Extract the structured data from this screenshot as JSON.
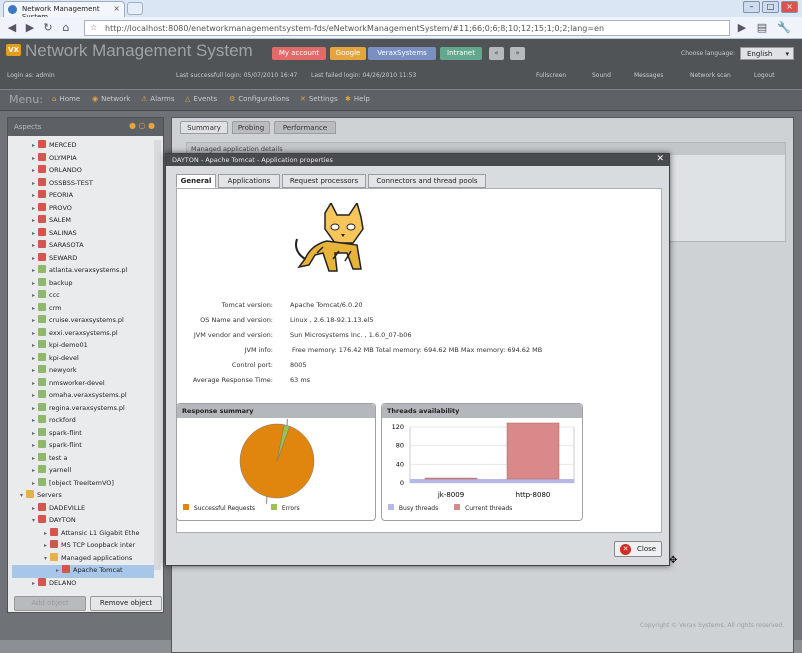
{
  "browser": {
    "tab_title": "Network Management System",
    "url": "http://localhost:8080/enetworkmanagementsystem-fds/eNetworkManagementSystem/#11;66;0;6;8;10;12;15;1;0;2;lang=en"
  },
  "app": {
    "logo": "VX",
    "title": "Network Management System",
    "quick_buttons": [
      {
        "label": "My account",
        "color": "#e46a6a"
      },
      {
        "label": "Google",
        "color": "#e5a43c"
      },
      {
        "label": "VeraxSystems",
        "color": "#7a8fc2"
      },
      {
        "label": "Intranet",
        "color": "#62a88e"
      }
    ],
    "choose_language_label": "Choose language:",
    "language": "English",
    "login_as": "Login as: admin",
    "last_success": "Last successfull login: 05/07/2010 16:47",
    "last_failed": "Last failed login: 04/26/2010 11:53",
    "top_links": [
      "Fullscreen",
      "Sound",
      "Messages",
      "Network scan",
      "Logout"
    ],
    "menu_label": "Menu:",
    "menu": [
      "Home",
      "Network",
      "Alarms",
      "Events",
      "Configurations",
      "Settings",
      "Help"
    ]
  },
  "aspects": {
    "title": "Aspects",
    "tree": [
      "MERCED",
      "OLYMPIA",
      "ORLANDO",
      "OSSBSS-TEST",
      "PEORIA",
      "PROVO",
      "SALEM",
      "SALINAS",
      "SARASOTA",
      "SEWARD",
      "atlanta.veraxsystems.pl",
      "backup",
      "ccc",
      "crm",
      "cruise.veraxsystems.pl",
      "exxi.veraxsystems.pl",
      "kpi-demo01",
      "kpi-devel",
      "newyork",
      "nmsworker-devel",
      "omaha.veraxsystems.pl",
      "regina.veraxsystems.pl",
      "rockford",
      "spark-flint",
      "spark-flint",
      "test a",
      "yarnell",
      "[object TreeItemVO]",
      "Servers",
      "DADEVILLE",
      "DAYTON",
      "Attansic L1 Gigabit Ethe",
      "MS TCP Loopback inter",
      "Managed applications",
      "Apache Tomcat",
      "DELANO"
    ],
    "add_button": "Add object",
    "remove_button": "Remove object"
  },
  "main": {
    "tabs": [
      "Summary",
      "Probing",
      "Performance"
    ],
    "section": "Managed application details"
  },
  "dialog": {
    "title": "DAYTON - Apache Tomcat - Application properties",
    "tabs": [
      "General",
      "Applications",
      "Request processors",
      "Connectors and thread pools"
    ],
    "props": [
      {
        "label": "Tomcat version:",
        "value": "Apache Tomcat/6.0.20"
      },
      {
        "label": "OS Name and version:",
        "value": "Linux , 2.6.18-92.1.13.el5"
      },
      {
        "label": "JVM vendor and version:",
        "value": "Sun Microsystems Inc. , 1.6.0_07-b06"
      },
      {
        "label": "JVM info:",
        "value": "Free memory: 176.42 MB Total memory: 694.62 MB Max memory: 694.62 MB"
      },
      {
        "label": "Control port:",
        "value": "8005"
      },
      {
        "label": "Average Response Time:",
        "value": "63 ms"
      }
    ],
    "response_summary": {
      "title": "Response summary",
      "legend": [
        "Successful Requests",
        "Errors"
      ]
    },
    "threads": {
      "title": "Threads availability",
      "legend": [
        "Busy threads",
        "Current threads"
      ]
    },
    "close": "Close"
  },
  "footer": "Copyright © Verax Systems. All rights reserved.",
  "chart_data": [
    {
      "type": "pie",
      "title": "Response summary",
      "labels": [
        "Successful Requests",
        "Errors"
      ],
      "values": [
        7853,
        191
      ],
      "colors": [
        "#e0860f",
        "#9ac155"
      ]
    },
    {
      "type": "bar",
      "title": "Threads availability",
      "categories": [
        "jk-8009",
        "http-8080"
      ],
      "series": [
        {
          "name": "Busy threads",
          "values": [
            0,
            0
          ],
          "color": "#b8b8e6"
        },
        {
          "name": "Current threads",
          "values": [
            2,
            120
          ],
          "color": "#d98989"
        }
      ],
      "ylim": [
        0,
        120
      ],
      "yticks": [
        0,
        40,
        80,
        120
      ]
    }
  ]
}
